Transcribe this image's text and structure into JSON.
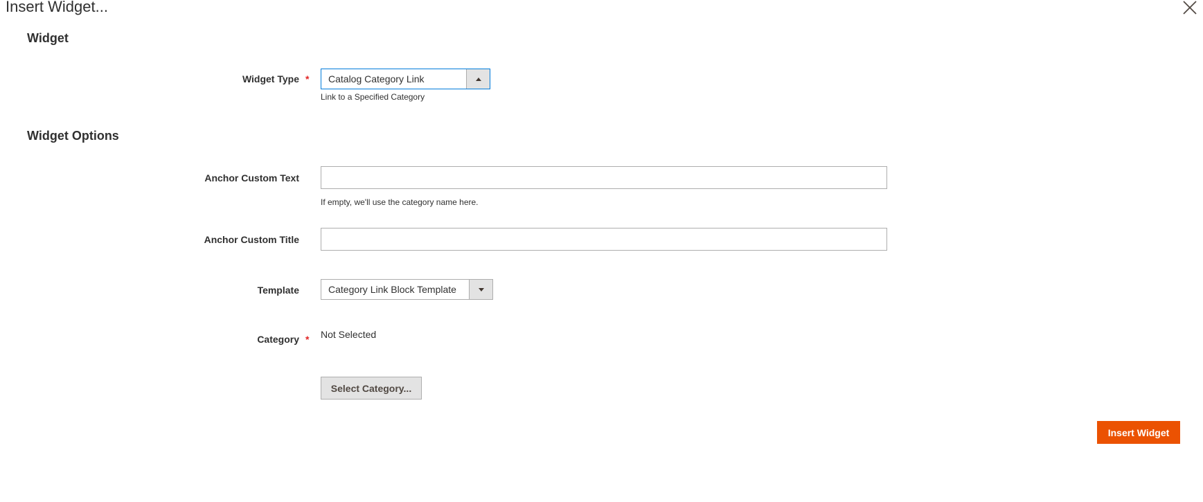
{
  "modal": {
    "title": "Insert Widget..."
  },
  "sections": {
    "widget_title": "Widget",
    "options_title": "Widget Options"
  },
  "widget_type": {
    "label": "Widget Type",
    "required_mark": "*",
    "selected": "Catalog Category Link",
    "note": "Link to a Specified Category"
  },
  "anchor_text": {
    "label": "Anchor Custom Text",
    "value": "",
    "note": "If empty, we'll use the category name here."
  },
  "anchor_title": {
    "label": "Anchor Custom Title",
    "value": ""
  },
  "template": {
    "label": "Template",
    "selected": "Category Link Block Template"
  },
  "category": {
    "label": "Category",
    "required_mark": "*",
    "value": "Not Selected",
    "button_label": "Select Category..."
  },
  "actions": {
    "insert_label": "Insert Widget"
  },
  "icons": {
    "close": "close-icon",
    "widget_type_arrow": "chevron-up-icon",
    "template_arrow": "chevron-down-icon"
  },
  "colors": {
    "accent": "#eb5202",
    "required": "#e22626",
    "focus": "#007bdb",
    "text": "#303030"
  }
}
